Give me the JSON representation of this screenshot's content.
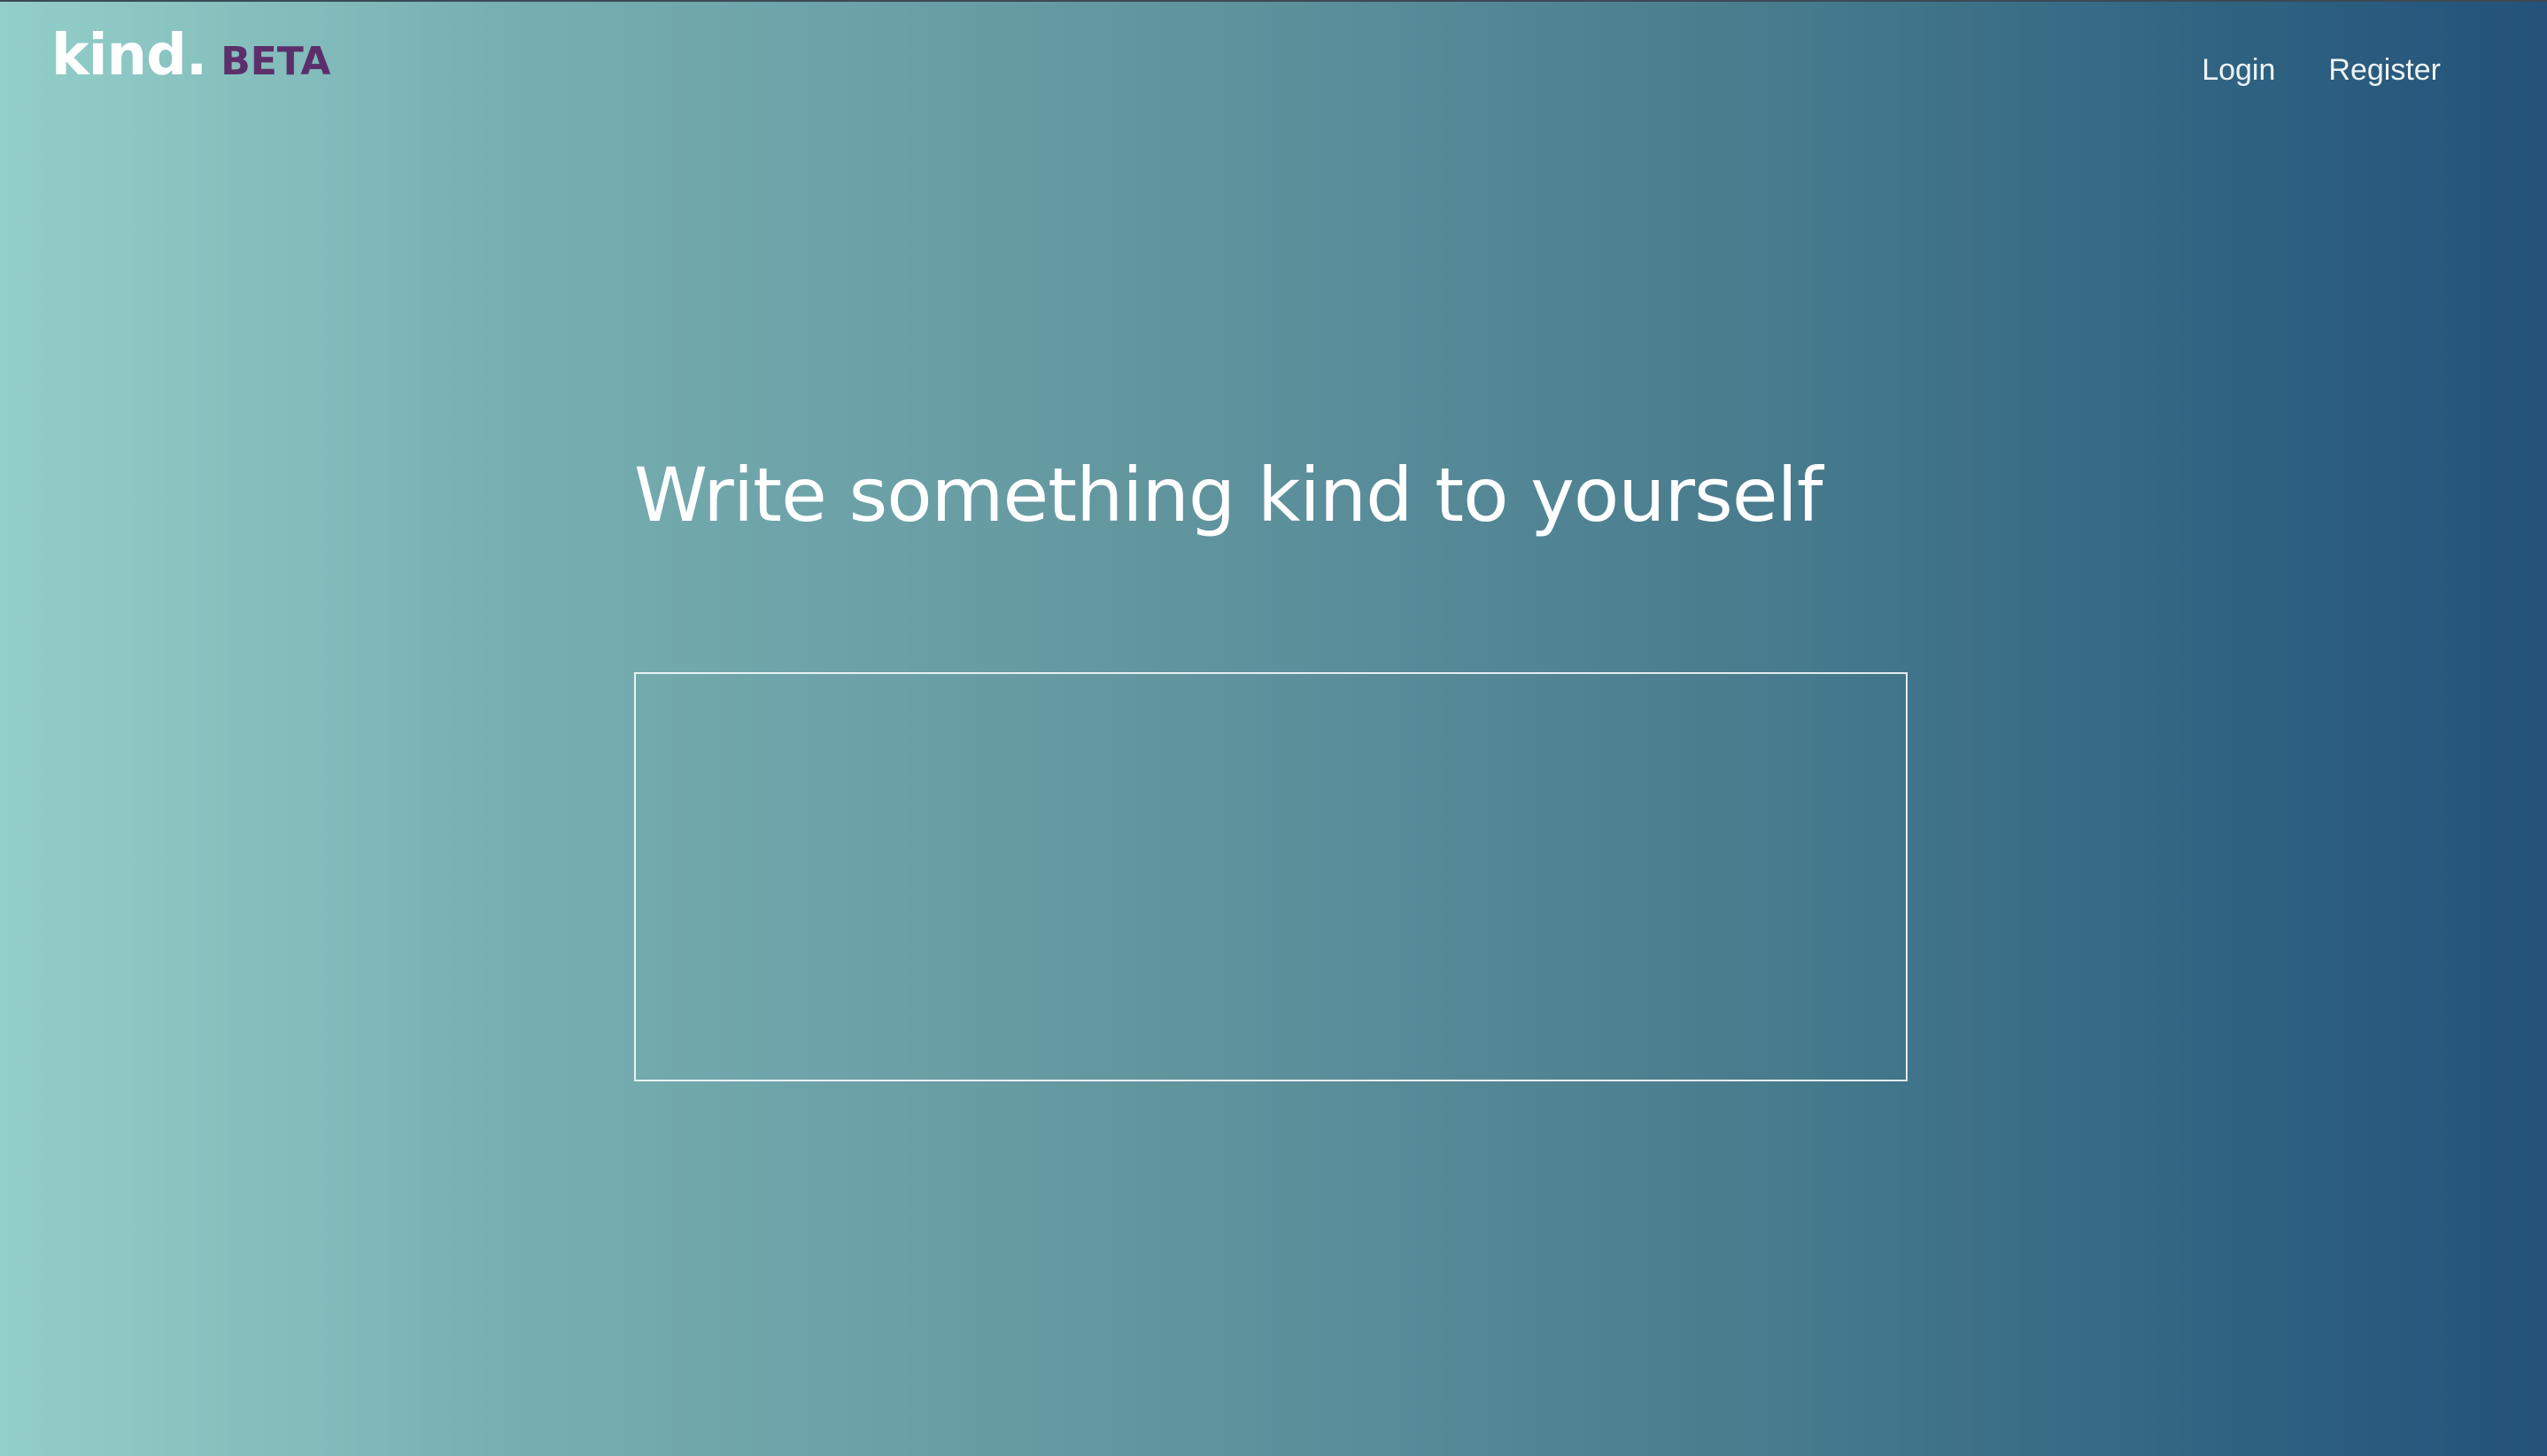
{
  "brand": {
    "name": "kind.",
    "badge": "BETA"
  },
  "nav": {
    "login_label": "Login",
    "register_label": "Register"
  },
  "main": {
    "headline": "Write something kind to yourself",
    "entry_value": "",
    "entry_placeholder": ""
  },
  "colors": {
    "gradient_start": "#93cfc9",
    "gradient_end": "#24527a",
    "badge": "#5c2f6b",
    "text": "#ffffff"
  }
}
